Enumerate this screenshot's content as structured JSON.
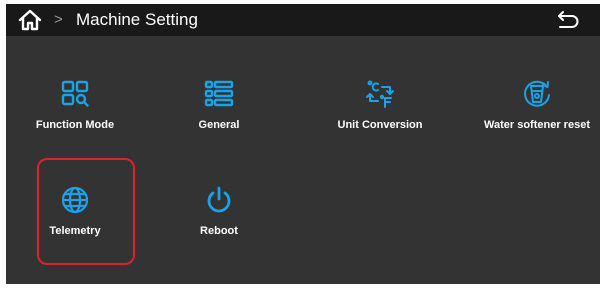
{
  "header": {
    "title": "Machine Setting",
    "breadcrumb_separator": ">",
    "home_icon": "home-icon",
    "back_icon": "back-arrow-icon"
  },
  "tiles": [
    {
      "label": "Function Mode",
      "icon": "function-mode-icon"
    },
    {
      "label": "General",
      "icon": "general-list-icon"
    },
    {
      "label": "Unit Conversion",
      "icon": "unit-conversion-icon"
    },
    {
      "label": "Water softener reset",
      "icon": "water-softener-icon"
    },
    {
      "label": "Telemetry",
      "icon": "globe-icon",
      "highlighted": true
    },
    {
      "label": "Reboot",
      "icon": "power-icon"
    }
  ],
  "colors": {
    "background": "#333333",
    "header": "#191919",
    "accent": "#1aa3e8",
    "highlight": "#e0202a"
  }
}
